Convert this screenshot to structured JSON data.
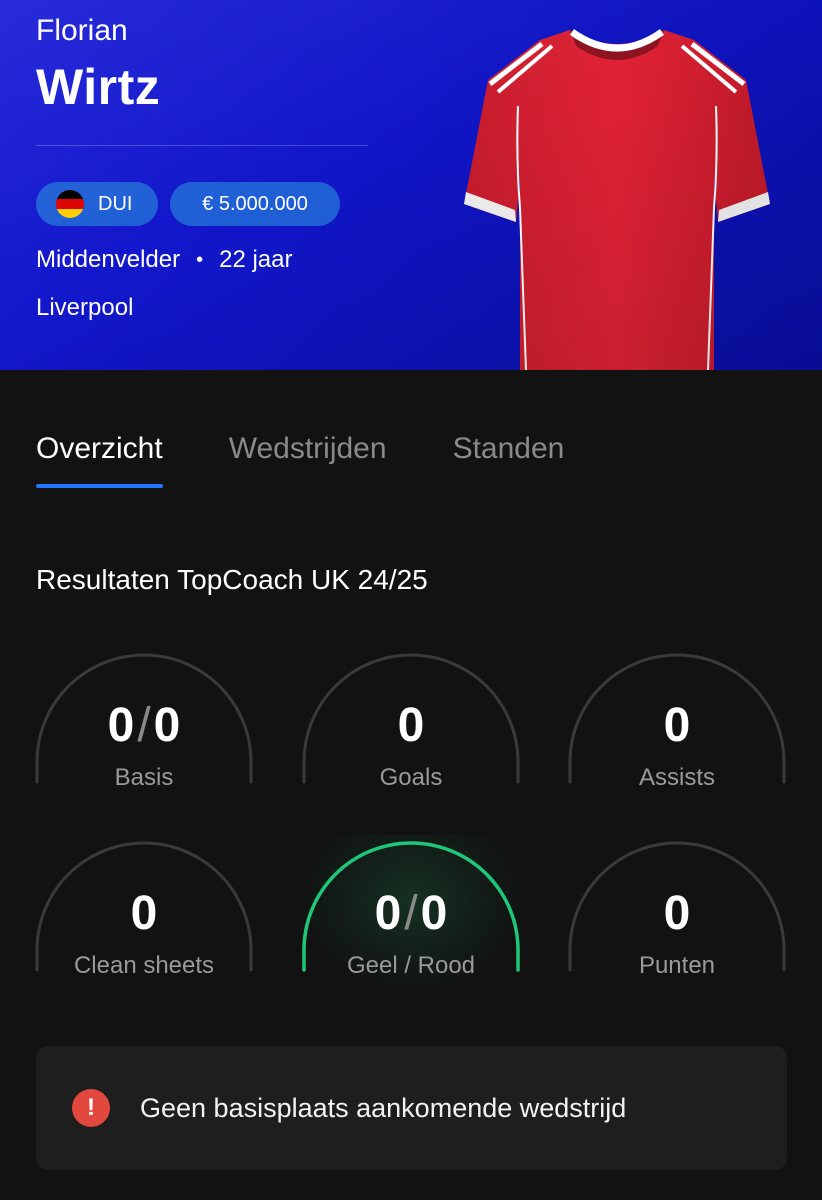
{
  "player": {
    "first_name": "Florian",
    "last_name": "Wirtz",
    "nationality": "DUI",
    "nationality_flag": "flag-germany-icon",
    "value": "€ 5.000.000",
    "position": "Middenvelder",
    "separator": "•",
    "age": "22 jaar",
    "club": "Liverpool",
    "shirt_icon": "red-football-shirt-icon"
  },
  "tabs": [
    {
      "label": "Overzicht",
      "active": true
    },
    {
      "label": "Wedstrijden",
      "active": false
    },
    {
      "label": "Standen",
      "active": false
    }
  ],
  "results": {
    "title": "Resultaten TopCoach UK 24/25",
    "stats": [
      {
        "id": "basis",
        "left": "0",
        "sep": "/",
        "right": "0",
        "label": "Basis",
        "highlight": false
      },
      {
        "id": "goals",
        "value": "0",
        "label": "Goals",
        "highlight": false
      },
      {
        "id": "assists",
        "value": "0",
        "label": "Assists",
        "highlight": false
      },
      {
        "id": "clean-sheets",
        "value": "0",
        "label": "Clean sheets",
        "highlight": false
      },
      {
        "id": "cards",
        "left": "0",
        "sep": "/",
        "right": "0",
        "label": "Geel / Rood",
        "highlight": true
      },
      {
        "id": "points",
        "value": "0",
        "label": "Punten",
        "highlight": false
      }
    ]
  },
  "notice": {
    "icon": "alert-icon",
    "icon_glyph": "!",
    "text": "Geen basisplaats aankomende wedstrijd"
  },
  "colors": {
    "hero_background": "#1116c9",
    "pill_background": "#1f5fd6",
    "tab_active_underline": "#1e78ff",
    "arc_neutral": "#3a3a3a",
    "arc_highlight": "#1ec77a",
    "alert_red": "#e2483d",
    "page_background": "#121212"
  }
}
